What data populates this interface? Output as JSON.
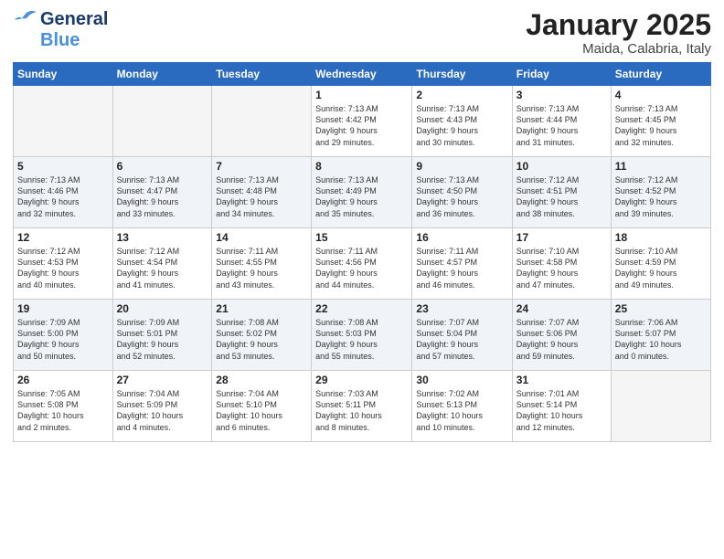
{
  "header": {
    "logo": {
      "part1": "General",
      "part2": "Blue"
    },
    "title": "January 2025",
    "location": "Maida, Calabria, Italy"
  },
  "calendar": {
    "weekdays": [
      "Sunday",
      "Monday",
      "Tuesday",
      "Wednesday",
      "Thursday",
      "Friday",
      "Saturday"
    ],
    "weeks": [
      [
        {
          "day": "",
          "info": ""
        },
        {
          "day": "",
          "info": ""
        },
        {
          "day": "",
          "info": ""
        },
        {
          "day": "1",
          "info": "Sunrise: 7:13 AM\nSunset: 4:42 PM\nDaylight: 9 hours\nand 29 minutes."
        },
        {
          "day": "2",
          "info": "Sunrise: 7:13 AM\nSunset: 4:43 PM\nDaylight: 9 hours\nand 30 minutes."
        },
        {
          "day": "3",
          "info": "Sunrise: 7:13 AM\nSunset: 4:44 PM\nDaylight: 9 hours\nand 31 minutes."
        },
        {
          "day": "4",
          "info": "Sunrise: 7:13 AM\nSunset: 4:45 PM\nDaylight: 9 hours\nand 32 minutes."
        }
      ],
      [
        {
          "day": "5",
          "info": "Sunrise: 7:13 AM\nSunset: 4:46 PM\nDaylight: 9 hours\nand 32 minutes."
        },
        {
          "day": "6",
          "info": "Sunrise: 7:13 AM\nSunset: 4:47 PM\nDaylight: 9 hours\nand 33 minutes."
        },
        {
          "day": "7",
          "info": "Sunrise: 7:13 AM\nSunset: 4:48 PM\nDaylight: 9 hours\nand 34 minutes."
        },
        {
          "day": "8",
          "info": "Sunrise: 7:13 AM\nSunset: 4:49 PM\nDaylight: 9 hours\nand 35 minutes."
        },
        {
          "day": "9",
          "info": "Sunrise: 7:13 AM\nSunset: 4:50 PM\nDaylight: 9 hours\nand 36 minutes."
        },
        {
          "day": "10",
          "info": "Sunrise: 7:12 AM\nSunset: 4:51 PM\nDaylight: 9 hours\nand 38 minutes."
        },
        {
          "day": "11",
          "info": "Sunrise: 7:12 AM\nSunset: 4:52 PM\nDaylight: 9 hours\nand 39 minutes."
        }
      ],
      [
        {
          "day": "12",
          "info": "Sunrise: 7:12 AM\nSunset: 4:53 PM\nDaylight: 9 hours\nand 40 minutes."
        },
        {
          "day": "13",
          "info": "Sunrise: 7:12 AM\nSunset: 4:54 PM\nDaylight: 9 hours\nand 41 minutes."
        },
        {
          "day": "14",
          "info": "Sunrise: 7:11 AM\nSunset: 4:55 PM\nDaylight: 9 hours\nand 43 minutes."
        },
        {
          "day": "15",
          "info": "Sunrise: 7:11 AM\nSunset: 4:56 PM\nDaylight: 9 hours\nand 44 minutes."
        },
        {
          "day": "16",
          "info": "Sunrise: 7:11 AM\nSunset: 4:57 PM\nDaylight: 9 hours\nand 46 minutes."
        },
        {
          "day": "17",
          "info": "Sunrise: 7:10 AM\nSunset: 4:58 PM\nDaylight: 9 hours\nand 47 minutes."
        },
        {
          "day": "18",
          "info": "Sunrise: 7:10 AM\nSunset: 4:59 PM\nDaylight: 9 hours\nand 49 minutes."
        }
      ],
      [
        {
          "day": "19",
          "info": "Sunrise: 7:09 AM\nSunset: 5:00 PM\nDaylight: 9 hours\nand 50 minutes."
        },
        {
          "day": "20",
          "info": "Sunrise: 7:09 AM\nSunset: 5:01 PM\nDaylight: 9 hours\nand 52 minutes."
        },
        {
          "day": "21",
          "info": "Sunrise: 7:08 AM\nSunset: 5:02 PM\nDaylight: 9 hours\nand 53 minutes."
        },
        {
          "day": "22",
          "info": "Sunrise: 7:08 AM\nSunset: 5:03 PM\nDaylight: 9 hours\nand 55 minutes."
        },
        {
          "day": "23",
          "info": "Sunrise: 7:07 AM\nSunset: 5:04 PM\nDaylight: 9 hours\nand 57 minutes."
        },
        {
          "day": "24",
          "info": "Sunrise: 7:07 AM\nSunset: 5:06 PM\nDaylight: 9 hours\nand 59 minutes."
        },
        {
          "day": "25",
          "info": "Sunrise: 7:06 AM\nSunset: 5:07 PM\nDaylight: 10 hours\nand 0 minutes."
        }
      ],
      [
        {
          "day": "26",
          "info": "Sunrise: 7:05 AM\nSunset: 5:08 PM\nDaylight: 10 hours\nand 2 minutes."
        },
        {
          "day": "27",
          "info": "Sunrise: 7:04 AM\nSunset: 5:09 PM\nDaylight: 10 hours\nand 4 minutes."
        },
        {
          "day": "28",
          "info": "Sunrise: 7:04 AM\nSunset: 5:10 PM\nDaylight: 10 hours\nand 6 minutes."
        },
        {
          "day": "29",
          "info": "Sunrise: 7:03 AM\nSunset: 5:11 PM\nDaylight: 10 hours\nand 8 minutes."
        },
        {
          "day": "30",
          "info": "Sunrise: 7:02 AM\nSunset: 5:13 PM\nDaylight: 10 hours\nand 10 minutes."
        },
        {
          "day": "31",
          "info": "Sunrise: 7:01 AM\nSunset: 5:14 PM\nDaylight: 10 hours\nand 12 minutes."
        },
        {
          "day": "",
          "info": ""
        }
      ]
    ]
  }
}
